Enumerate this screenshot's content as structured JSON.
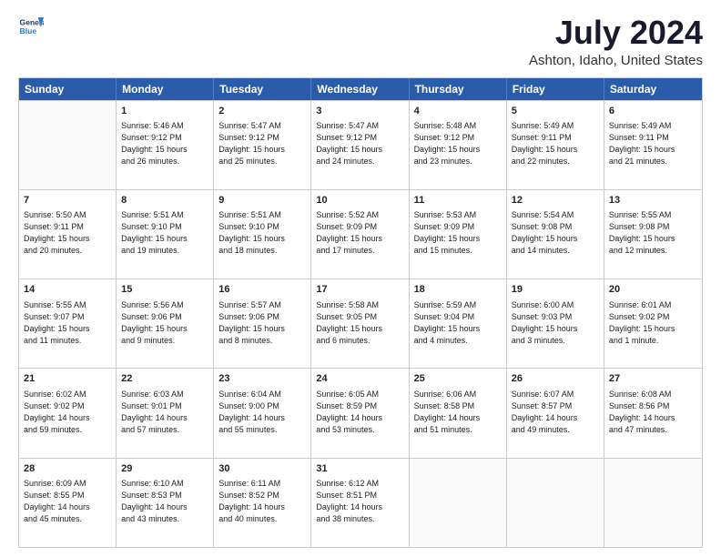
{
  "header": {
    "logo_line1": "General",
    "logo_line2": "Blue",
    "main_title": "July 2024",
    "subtitle": "Ashton, Idaho, United States"
  },
  "calendar": {
    "days_of_week": [
      "Sunday",
      "Monday",
      "Tuesday",
      "Wednesday",
      "Thursday",
      "Friday",
      "Saturday"
    ],
    "weeks": [
      [
        {
          "day": "",
          "info": ""
        },
        {
          "day": "1",
          "info": "Sunrise: 5:46 AM\nSunset: 9:12 PM\nDaylight: 15 hours\nand 26 minutes."
        },
        {
          "day": "2",
          "info": "Sunrise: 5:47 AM\nSunset: 9:12 PM\nDaylight: 15 hours\nand 25 minutes."
        },
        {
          "day": "3",
          "info": "Sunrise: 5:47 AM\nSunset: 9:12 PM\nDaylight: 15 hours\nand 24 minutes."
        },
        {
          "day": "4",
          "info": "Sunrise: 5:48 AM\nSunset: 9:12 PM\nDaylight: 15 hours\nand 23 minutes."
        },
        {
          "day": "5",
          "info": "Sunrise: 5:49 AM\nSunset: 9:11 PM\nDaylight: 15 hours\nand 22 minutes."
        },
        {
          "day": "6",
          "info": "Sunrise: 5:49 AM\nSunset: 9:11 PM\nDaylight: 15 hours\nand 21 minutes."
        }
      ],
      [
        {
          "day": "7",
          "info": "Sunrise: 5:50 AM\nSunset: 9:11 PM\nDaylight: 15 hours\nand 20 minutes."
        },
        {
          "day": "8",
          "info": "Sunrise: 5:51 AM\nSunset: 9:10 PM\nDaylight: 15 hours\nand 19 minutes."
        },
        {
          "day": "9",
          "info": "Sunrise: 5:51 AM\nSunset: 9:10 PM\nDaylight: 15 hours\nand 18 minutes."
        },
        {
          "day": "10",
          "info": "Sunrise: 5:52 AM\nSunset: 9:09 PM\nDaylight: 15 hours\nand 17 minutes."
        },
        {
          "day": "11",
          "info": "Sunrise: 5:53 AM\nSunset: 9:09 PM\nDaylight: 15 hours\nand 15 minutes."
        },
        {
          "day": "12",
          "info": "Sunrise: 5:54 AM\nSunset: 9:08 PM\nDaylight: 15 hours\nand 14 minutes."
        },
        {
          "day": "13",
          "info": "Sunrise: 5:55 AM\nSunset: 9:08 PM\nDaylight: 15 hours\nand 12 minutes."
        }
      ],
      [
        {
          "day": "14",
          "info": "Sunrise: 5:55 AM\nSunset: 9:07 PM\nDaylight: 15 hours\nand 11 minutes."
        },
        {
          "day": "15",
          "info": "Sunrise: 5:56 AM\nSunset: 9:06 PM\nDaylight: 15 hours\nand 9 minutes."
        },
        {
          "day": "16",
          "info": "Sunrise: 5:57 AM\nSunset: 9:06 PM\nDaylight: 15 hours\nand 8 minutes."
        },
        {
          "day": "17",
          "info": "Sunrise: 5:58 AM\nSunset: 9:05 PM\nDaylight: 15 hours\nand 6 minutes."
        },
        {
          "day": "18",
          "info": "Sunrise: 5:59 AM\nSunset: 9:04 PM\nDaylight: 15 hours\nand 4 minutes."
        },
        {
          "day": "19",
          "info": "Sunrise: 6:00 AM\nSunset: 9:03 PM\nDaylight: 15 hours\nand 3 minutes."
        },
        {
          "day": "20",
          "info": "Sunrise: 6:01 AM\nSunset: 9:02 PM\nDaylight: 15 hours\nand 1 minute."
        }
      ],
      [
        {
          "day": "21",
          "info": "Sunrise: 6:02 AM\nSunset: 9:02 PM\nDaylight: 14 hours\nand 59 minutes."
        },
        {
          "day": "22",
          "info": "Sunrise: 6:03 AM\nSunset: 9:01 PM\nDaylight: 14 hours\nand 57 minutes."
        },
        {
          "day": "23",
          "info": "Sunrise: 6:04 AM\nSunset: 9:00 PM\nDaylight: 14 hours\nand 55 minutes."
        },
        {
          "day": "24",
          "info": "Sunrise: 6:05 AM\nSunset: 8:59 PM\nDaylight: 14 hours\nand 53 minutes."
        },
        {
          "day": "25",
          "info": "Sunrise: 6:06 AM\nSunset: 8:58 PM\nDaylight: 14 hours\nand 51 minutes."
        },
        {
          "day": "26",
          "info": "Sunrise: 6:07 AM\nSunset: 8:57 PM\nDaylight: 14 hours\nand 49 minutes."
        },
        {
          "day": "27",
          "info": "Sunrise: 6:08 AM\nSunset: 8:56 PM\nDaylight: 14 hours\nand 47 minutes."
        }
      ],
      [
        {
          "day": "28",
          "info": "Sunrise: 6:09 AM\nSunset: 8:55 PM\nDaylight: 14 hours\nand 45 minutes."
        },
        {
          "day": "29",
          "info": "Sunrise: 6:10 AM\nSunset: 8:53 PM\nDaylight: 14 hours\nand 43 minutes."
        },
        {
          "day": "30",
          "info": "Sunrise: 6:11 AM\nSunset: 8:52 PM\nDaylight: 14 hours\nand 40 minutes."
        },
        {
          "day": "31",
          "info": "Sunrise: 6:12 AM\nSunset: 8:51 PM\nDaylight: 14 hours\nand 38 minutes."
        },
        {
          "day": "",
          "info": ""
        },
        {
          "day": "",
          "info": ""
        },
        {
          "day": "",
          "info": ""
        }
      ]
    ]
  }
}
